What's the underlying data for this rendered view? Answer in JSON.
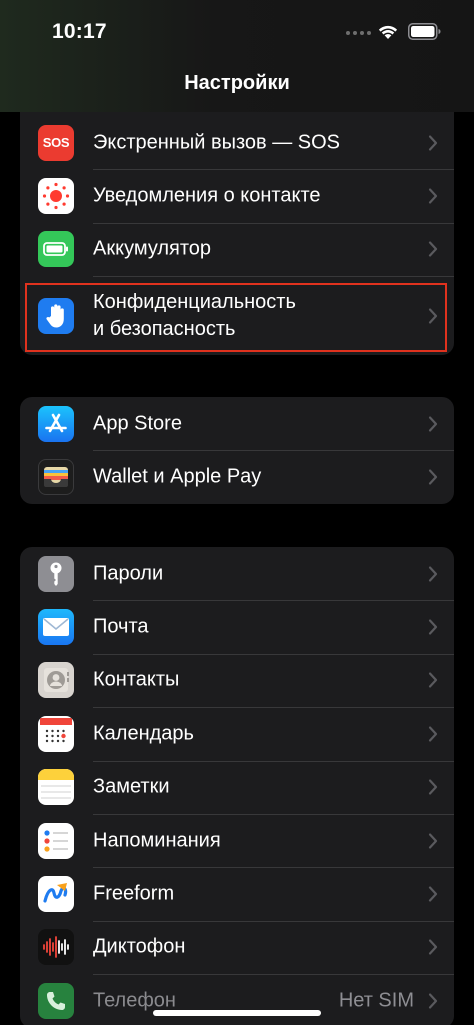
{
  "status_bar": {
    "time": "10:17"
  },
  "nav": {
    "title": "Настройки"
  },
  "groups": [
    {
      "items": [
        {
          "label": "Экстренный вызов — SOS",
          "icon": "sos-icon",
          "icon_text": "SOS"
        },
        {
          "label": "Уведомления о контакте",
          "icon": "exposure-notification-icon"
        },
        {
          "label": "Аккумулятор",
          "icon": "battery-icon"
        },
        {
          "label_line1": "Конфиденциальность",
          "label_line2": "и безопасность",
          "icon": "hand-privacy-icon",
          "highlighted": true
        }
      ]
    },
    {
      "items": [
        {
          "label": "App Store",
          "icon": "app-store-icon"
        },
        {
          "label": "Wallet и Apple Pay",
          "icon": "wallet-icon"
        }
      ]
    },
    {
      "items": [
        {
          "label": "Пароли",
          "icon": "key-icon"
        },
        {
          "label": "Почта",
          "icon": "mail-icon"
        },
        {
          "label": "Контакты",
          "icon": "contacts-icon"
        },
        {
          "label": "Календарь",
          "icon": "calendar-icon"
        },
        {
          "label": "Заметки",
          "icon": "notes-icon"
        },
        {
          "label": "Напоминания",
          "icon": "reminders-icon"
        },
        {
          "label": "Freeform",
          "icon": "freeform-icon"
        },
        {
          "label": "Диктофон",
          "icon": "voice-memos-icon"
        },
        {
          "label": "Телефон",
          "icon": "phone-icon",
          "value": "Нет SIM"
        }
      ]
    }
  ],
  "colors": {
    "background": "#000000",
    "group_background": "#1c1c1e",
    "separator": "#38383a",
    "highlight_border": "#e0321e",
    "sos_red": "#eb3b30",
    "battery_green": "#34c759",
    "privacy_blue": "#1f7cf0"
  }
}
